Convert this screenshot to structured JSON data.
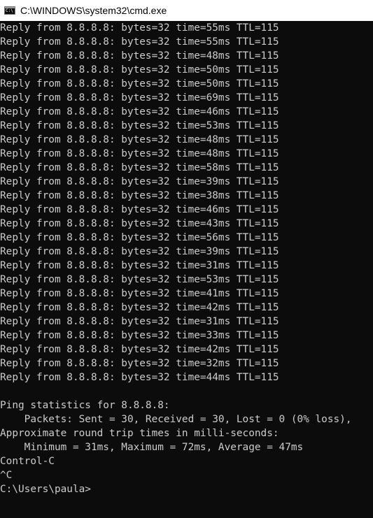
{
  "window": {
    "title": "C:\\WINDOWS\\system32\\cmd.exe",
    "icon": "cmd-icon",
    "icon_label": "C:\\"
  },
  "console": {
    "lines": [
      "Reply from 8.8.8.8: bytes=32 time=55ms TTL=115",
      "Reply from 8.8.8.8: bytes=32 time=55ms TTL=115",
      "Reply from 8.8.8.8: bytes=32 time=48ms TTL=115",
      "Reply from 8.8.8.8: bytes=32 time=50ms TTL=115",
      "Reply from 8.8.8.8: bytes=32 time=50ms TTL=115",
      "Reply from 8.8.8.8: bytes=32 time=69ms TTL=115",
      "Reply from 8.8.8.8: bytes=32 time=46ms TTL=115",
      "Reply from 8.8.8.8: bytes=32 time=53ms TTL=115",
      "Reply from 8.8.8.8: bytes=32 time=48ms TTL=115",
      "Reply from 8.8.8.8: bytes=32 time=48ms TTL=115",
      "Reply from 8.8.8.8: bytes=32 time=58ms TTL=115",
      "Reply from 8.8.8.8: bytes=32 time=39ms TTL=115",
      "Reply from 8.8.8.8: bytes=32 time=38ms TTL=115",
      "Reply from 8.8.8.8: bytes=32 time=46ms TTL=115",
      "Reply from 8.8.8.8: bytes=32 time=43ms TTL=115",
      "Reply from 8.8.8.8: bytes=32 time=56ms TTL=115",
      "Reply from 8.8.8.8: bytes=32 time=39ms TTL=115",
      "Reply from 8.8.8.8: bytes=32 time=31ms TTL=115",
      "Reply from 8.8.8.8: bytes=32 time=53ms TTL=115",
      "Reply from 8.8.8.8: bytes=32 time=41ms TTL=115",
      "Reply from 8.8.8.8: bytes=32 time=42ms TTL=115",
      "Reply from 8.8.8.8: bytes=32 time=31ms TTL=115",
      "Reply from 8.8.8.8: bytes=32 time=33ms TTL=115",
      "Reply from 8.8.8.8: bytes=32 time=42ms TTL=115",
      "Reply from 8.8.8.8: bytes=32 time=32ms TTL=115",
      "Reply from 8.8.8.8: bytes=32 time=44ms TTL=115",
      "",
      "Ping statistics for 8.8.8.8:",
      "    Packets: Sent = 30, Received = 30, Lost = 0 (0% loss),",
      "Approximate round trip times in milli-seconds:",
      "    Minimum = 31ms, Maximum = 72ms, Average = 47ms",
      "Control-C",
      "^C",
      "C:\\Users\\paula>"
    ]
  },
  "colors": {
    "background": "#0c0c0c",
    "text": "#cccccc",
    "titlebar": "#ffffff"
  }
}
